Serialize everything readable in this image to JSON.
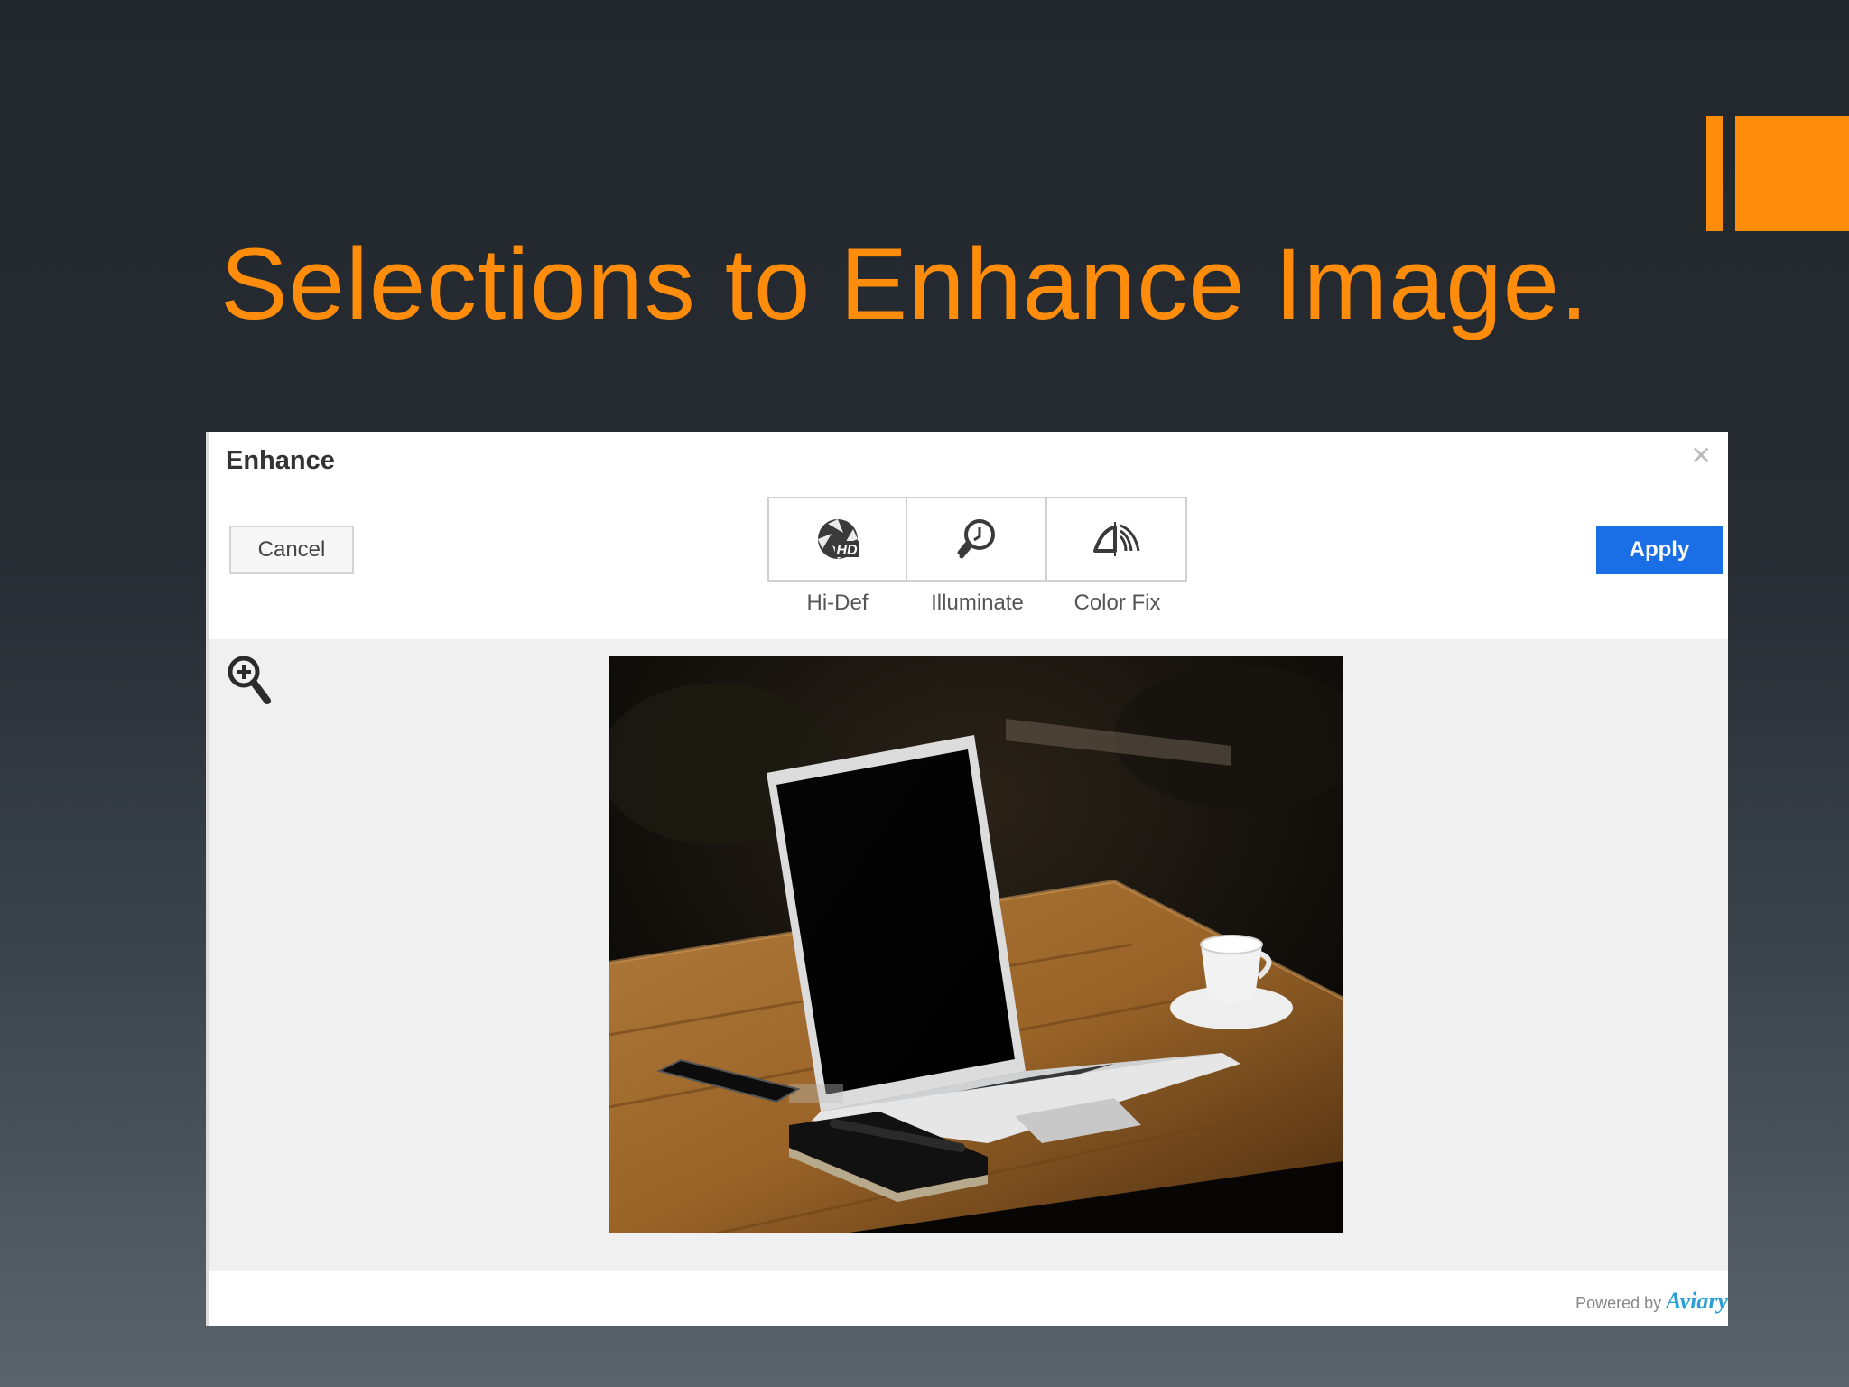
{
  "slide": {
    "title": "Selections to Enhance Image.",
    "accent_color": "#ff8c0a"
  },
  "dialog": {
    "title": "Enhance",
    "close_icon": "close-icon",
    "cancel_label": "Cancel",
    "apply_label": "Apply",
    "apply_color": "#1a6ee6",
    "tools": [
      {
        "label": "Hi-Def",
        "icon": "hd-aperture-icon"
      },
      {
        "label": "Illuminate",
        "icon": "lightbulb-icon"
      },
      {
        "label": "Color Fix",
        "icon": "color-fix-icon"
      }
    ],
    "zoom_icon": "zoom-in-icon",
    "image_subject": "photo",
    "footer": {
      "powered_by": "Powered by",
      "brand": "Aviary"
    }
  }
}
